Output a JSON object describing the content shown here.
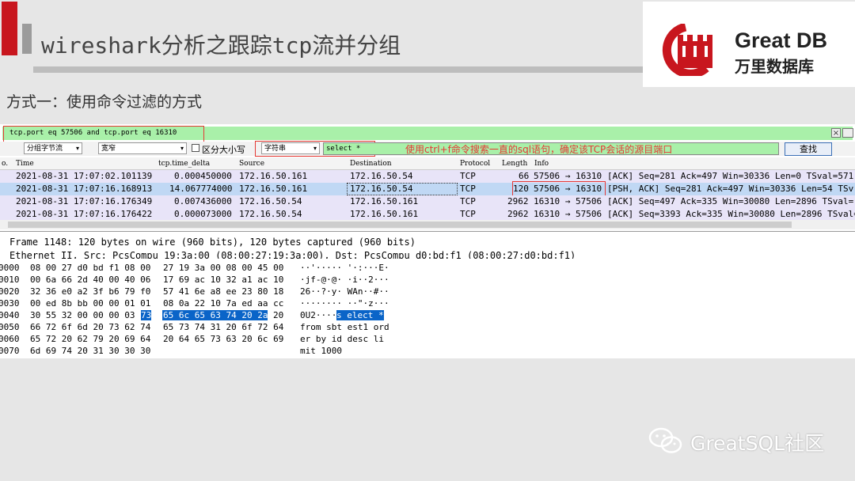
{
  "slide": {
    "title": "wireshark分析之跟踪tcp流并分组",
    "subtitle": "方式一：使用命令过滤的方式",
    "logo_en": "Great DB",
    "logo_cn": "万里数据库",
    "watermark": "GreatSQL社区"
  },
  "filter": {
    "value": "tcp.port eq 57506 and tcp.port eq 16310",
    "clear": "×"
  },
  "find": {
    "scope": "分组字节流",
    "charset": "宽窄",
    "case_label": "区分大小写",
    "type": "字符串",
    "value": "select *",
    "annotation": "使用ctrl+f命令搜索一直的sql语句，确定该TCP会话的源目端口",
    "button": "查找"
  },
  "columns": {
    "no": "o.",
    "time": "Time",
    "delta": "tcp.time_delta",
    "src": "Source",
    "dst": "Destination",
    "proto": "Protocol",
    "len": "Length",
    "info": "Info"
  },
  "packets": [
    {
      "time": "2021-08-31 17:07:02.101139",
      "delta": "0.000450000",
      "src": "172.16.50.161",
      "dst": "172.16.50.54",
      "proto": "TCP",
      "len": "66",
      "ports": "57506 → 16310",
      "info": "[ACK] Seq=281 Ack=497 Win=30336 Len=0 TSval=571"
    },
    {
      "time": "2021-08-31 17:07:16.168913",
      "delta": "14.067774000",
      "src": "172.16.50.161",
      "dst": "172.16.50.54",
      "proto": "TCP",
      "len": "120",
      "ports": "57506 → 16310",
      "info": "[PSH, ACK] Seq=281 Ack=497 Win=30336 Len=54 TSv"
    },
    {
      "time": "2021-08-31 17:07:16.176349",
      "delta": "0.007436000",
      "src": "172.16.50.54",
      "dst": "172.16.50.161",
      "proto": "TCP",
      "len": "2962",
      "ports": "16310 → 57506",
      "info": "[ACK] Seq=497 Ack=335 Win=30080 Len=2896 TSval="
    },
    {
      "time": "2021-08-31 17:07:16.176422",
      "delta": "0.000073000",
      "src": "172.16.50.54",
      "dst": "172.16.50.161",
      "proto": "TCP",
      "len": "2962",
      "ports": "16310 → 57506",
      "info": "[ACK] Seq=3393 Ack=335 Win=30080 Len=2896 TSval="
    }
  ],
  "detail": {
    "frame": "Frame 1148: 120 bytes on wire (960 bits), 120 bytes captured (960 bits)",
    "ethernet": "Ethernet II, Src: PcsCompu_19:3a:00 (08:00:27:19:3a:00), Dst: PcsCompu_d0:bd:f1 (08:00:27:d0:bd:f1)"
  },
  "hex": [
    {
      "off": "0000",
      "a": "08 00 27 d0 bd f1 08 00",
      "b": "27 19 3a 00 08 00 45 00",
      "asc": "··'····· '·:···E·"
    },
    {
      "off": "0010",
      "a": "00 6a 66 2d 40 00 40 06",
      "b": "17 69 ac 10 32 a1 ac 10",
      "asc": "·jf-@·@· ·i··2···"
    },
    {
      "off": "0020",
      "a": "32 36 e0 a2 3f b6 79 f0",
      "b": "57 41 6e a8 ee 23 80 18",
      "asc": "26··?·y· WAn··#··"
    },
    {
      "off": "0030",
      "a": "00 ed 8b bb 00 00 01 01",
      "b": "08 0a 22 10 7a ed aa cc",
      "asc": "········ ··\"·z···"
    },
    {
      "off": "0040",
      "a": "30 55 32 00 00 00 03",
      "a_sel": "73",
      "b_sel": "65 6c 65 63 74 20 2a",
      "b": "20",
      "asc": "0U2····",
      "asc_sel": "s elect *"
    },
    {
      "off": "0050",
      "a": "66 72 6f 6d 20 73 62 74",
      "b": "65 73 74 31 20 6f 72 64",
      "asc": "from sbt est1 ord"
    },
    {
      "off": "0060",
      "a": "65 72 20 62 79 20 69 64",
      "b": "20 64 65 73 63 20 6c 69",
      "asc": "er by id  desc li"
    },
    {
      "off": "0070",
      "a": "6d 69 74 20 31 30 30 30",
      "b": "",
      "asc": "mit 1000"
    }
  ],
  "colors": {
    "accent_red": "#c8161e",
    "filter_green": "#a9f0a9",
    "selected_row": "#c0d8f4",
    "hex_select": "#0a64c8"
  }
}
